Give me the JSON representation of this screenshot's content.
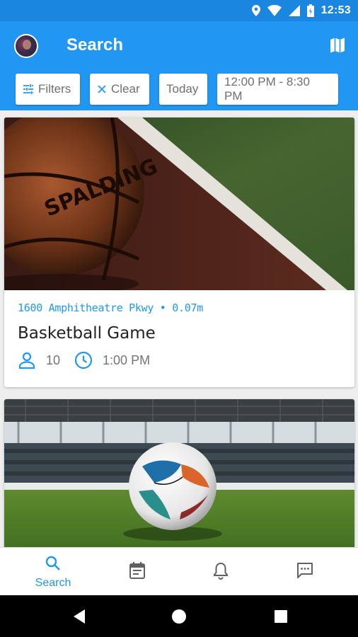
{
  "status_bar": {
    "time": "12:53",
    "icons": [
      "location-icon",
      "wifi-icon",
      "signal-icon",
      "battery-icon"
    ]
  },
  "app_bar": {
    "title": "Search",
    "background": "#2196f3",
    "actions": [
      "map-icon"
    ]
  },
  "filters": {
    "filters_label": "Filters",
    "clear_label": "Clear",
    "date_label": "Today",
    "time_range_label": "12:00 PM - 8:30 PM"
  },
  "cards": [
    {
      "image": "basketball-on-court-photo",
      "address": "1600 Amphitheatre Pkwy • 0.07m",
      "title": "Basketball Game",
      "players": "10",
      "time": "1:00 PM"
    },
    {
      "image": "soccer-ball-in-stadium-photo"
    }
  ],
  "bottom_nav": {
    "active": "search",
    "items": [
      {
        "id": "search",
        "label": "Search",
        "icon": "search-icon"
      },
      {
        "id": "calendar",
        "icon": "calendar-icon"
      },
      {
        "id": "notifications",
        "icon": "bell-icon"
      },
      {
        "id": "messages",
        "icon": "chat-icon"
      }
    ]
  },
  "colors": {
    "primary": "#2196f3",
    "status_bar": "#1a86e0",
    "background": "#eeeeee"
  }
}
